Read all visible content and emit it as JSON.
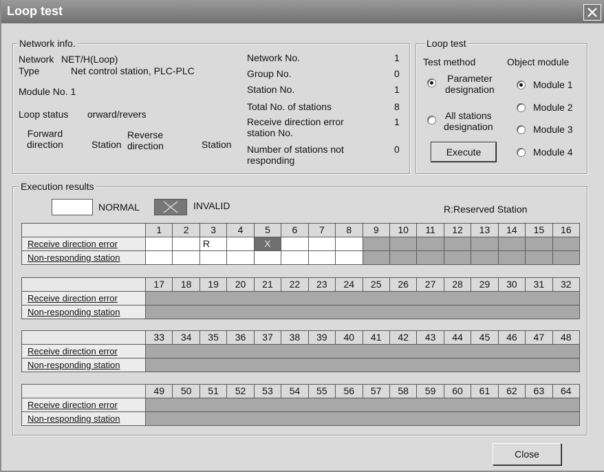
{
  "window": {
    "title": "Loop test",
    "close_glyph": "close-icon"
  },
  "network_info": {
    "legend": "Network info.",
    "network_label": "Network",
    "network_value": "NET/H(Loop)",
    "type_label": "Type",
    "type_value": "Net control station, PLC-PLC",
    "module_no": "Module No.  1",
    "loop_status_label": "Loop status",
    "loop_status_value": "orward/revers",
    "col_forward": "Forward\ndirection",
    "col_station1": "Station",
    "col_reverse": "Reverse\ndirection",
    "col_station2": "Station",
    "stats": [
      {
        "label": "Network No.",
        "value": "1"
      },
      {
        "label": "Group No.",
        "value": "0"
      },
      {
        "label": "Station No.",
        "value": "1"
      },
      {
        "label": "Total No. of stations",
        "value": "8"
      },
      {
        "label": "Receive direction error\nstation No.",
        "value": "1"
      },
      {
        "label": "Number of stations not\nresponding",
        "value": "0"
      }
    ]
  },
  "loop_test": {
    "legend": "Loop test",
    "test_method_label": "Test method",
    "object_module_label": "Object module",
    "methods": [
      {
        "label": "Parameter\ndesignation",
        "selected": true
      },
      {
        "label": "All stations\ndesignation",
        "selected": false
      }
    ],
    "modules": [
      {
        "label": "Module 1",
        "selected": true
      },
      {
        "label": "Module 2",
        "selected": false
      },
      {
        "label": "Module 3",
        "selected": false
      },
      {
        "label": "Module 4",
        "selected": false
      }
    ],
    "execute_label": "Execute"
  },
  "results": {
    "legend": "Execution results",
    "normal_label": "NORMAL",
    "invalid_label": "INVALID",
    "reserved_note": "R:Reserved Station",
    "row_labels": [
      "Receive direction error",
      "Non-responding station"
    ],
    "blocks": [
      {
        "stations": [
          "1",
          "2",
          "3",
          "4",
          "5",
          "6",
          "7",
          "8",
          "9",
          "10",
          "11",
          "12",
          "13",
          "14",
          "15",
          "16"
        ],
        "receive": [
          {
            "s": "normal",
            "t": ""
          },
          {
            "s": "normal",
            "t": ""
          },
          {
            "s": "normal",
            "t": "R"
          },
          {
            "s": "normal",
            "t": ""
          },
          {
            "s": "invalid",
            "t": "X"
          },
          {
            "s": "normal",
            "t": ""
          },
          {
            "s": "normal",
            "t": ""
          },
          {
            "s": "normal",
            "t": ""
          },
          {
            "s": "disabled",
            "t": ""
          },
          {
            "s": "disabled",
            "t": ""
          },
          {
            "s": "disabled",
            "t": ""
          },
          {
            "s": "disabled",
            "t": ""
          },
          {
            "s": "disabled",
            "t": ""
          },
          {
            "s": "disabled",
            "t": ""
          },
          {
            "s": "disabled",
            "t": ""
          },
          {
            "s": "disabled",
            "t": ""
          }
        ],
        "nonresp": [
          {
            "s": "normal",
            "t": ""
          },
          {
            "s": "normal",
            "t": ""
          },
          {
            "s": "normal",
            "t": ""
          },
          {
            "s": "normal",
            "t": ""
          },
          {
            "s": "normal",
            "t": ""
          },
          {
            "s": "normal",
            "t": ""
          },
          {
            "s": "normal",
            "t": ""
          },
          {
            "s": "normal",
            "t": ""
          },
          {
            "s": "disabled",
            "t": ""
          },
          {
            "s": "disabled",
            "t": ""
          },
          {
            "s": "disabled",
            "t": ""
          },
          {
            "s": "disabled",
            "t": ""
          },
          {
            "s": "disabled",
            "t": ""
          },
          {
            "s": "disabled",
            "t": ""
          },
          {
            "s": "disabled",
            "t": ""
          },
          {
            "s": "disabled",
            "t": ""
          }
        ]
      },
      {
        "stations": [
          "17",
          "18",
          "19",
          "20",
          "21",
          "22",
          "23",
          "24",
          "25",
          "26",
          "27",
          "28",
          "29",
          "30",
          "31",
          "32"
        ],
        "all_disabled": true
      },
      {
        "stations": [
          "33",
          "34",
          "35",
          "36",
          "37",
          "38",
          "39",
          "40",
          "41",
          "42",
          "43",
          "44",
          "45",
          "46",
          "47",
          "48"
        ],
        "all_disabled": true
      },
      {
        "stations": [
          "49",
          "50",
          "51",
          "52",
          "53",
          "54",
          "55",
          "56",
          "57",
          "58",
          "59",
          "60",
          "61",
          "62",
          "63",
          "64"
        ],
        "all_disabled": true
      }
    ]
  },
  "footer": {
    "close_label": "Close"
  }
}
